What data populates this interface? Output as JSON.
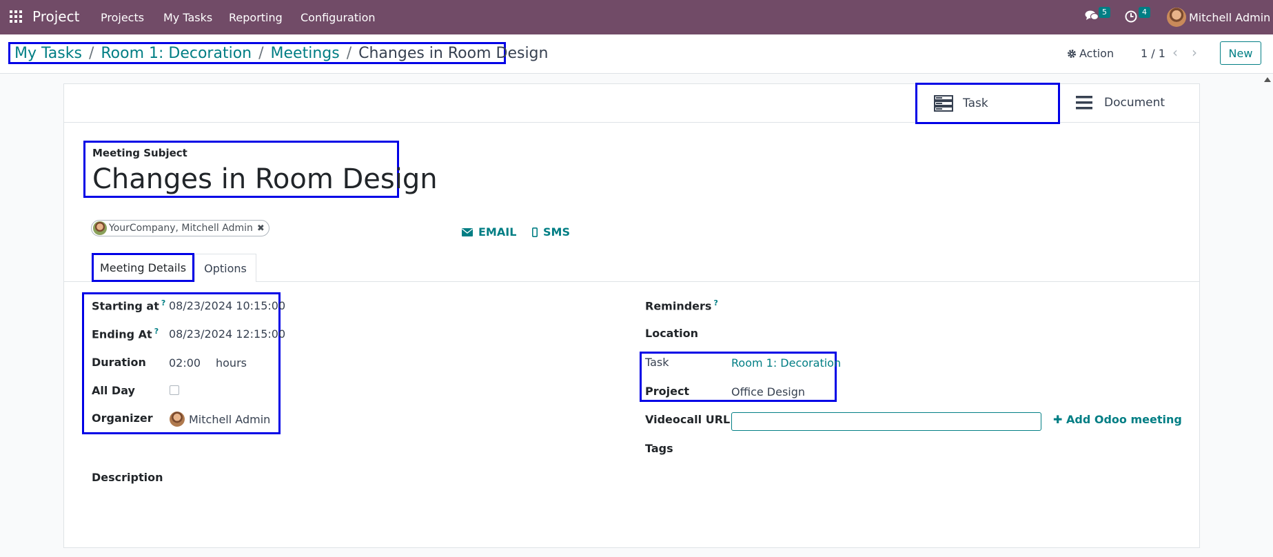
{
  "navbar": {
    "app_name": "Project",
    "menu": [
      "Projects",
      "My Tasks",
      "Reporting",
      "Configuration"
    ],
    "messages_count": "5",
    "activities_count": "4",
    "user_name": "Mitchell Admin"
  },
  "breadcrumb": {
    "items": [
      "My Tasks",
      "Room 1: Decoration",
      "Meetings"
    ],
    "current": "Changes in Room Design"
  },
  "control": {
    "action_label": "Action",
    "pager": "1 / 1",
    "new_label": "New"
  },
  "smart_buttons": {
    "task": "Task",
    "document": "Document"
  },
  "form": {
    "subject_label": "Meeting Subject",
    "subject_value": "Changes in Room Design",
    "attendee": "YourCompany, Mitchell Admin",
    "email_label": "EMAIL",
    "sms_label": "SMS",
    "tabs": [
      "Meeting Details",
      "Options"
    ],
    "left": {
      "starting_label": "Starting at",
      "starting_value": "08/23/2024 10:15:00",
      "ending_label": "Ending At",
      "ending_value": "08/23/2024 12:15:00",
      "duration_label": "Duration",
      "duration_value": "02:00",
      "duration_unit": "hours",
      "allday_label": "All Day",
      "organizer_label": "Organizer",
      "organizer_value": "Mitchell Admin",
      "description_label": "Description"
    },
    "right": {
      "reminders_label": "Reminders",
      "location_label": "Location",
      "task_label": "Task",
      "task_value": "Room 1: Decoration",
      "project_label": "Project",
      "project_value": "Office Design",
      "videocall_label": "Videocall URL",
      "videocall_value": "",
      "add_meeting_label": "Add Odoo meeting",
      "tags_label": "Tags"
    },
    "help_mark": "?"
  },
  "colors": {
    "navbar": "#714b67",
    "accent": "#017e84",
    "highlight": "#0000e6"
  }
}
